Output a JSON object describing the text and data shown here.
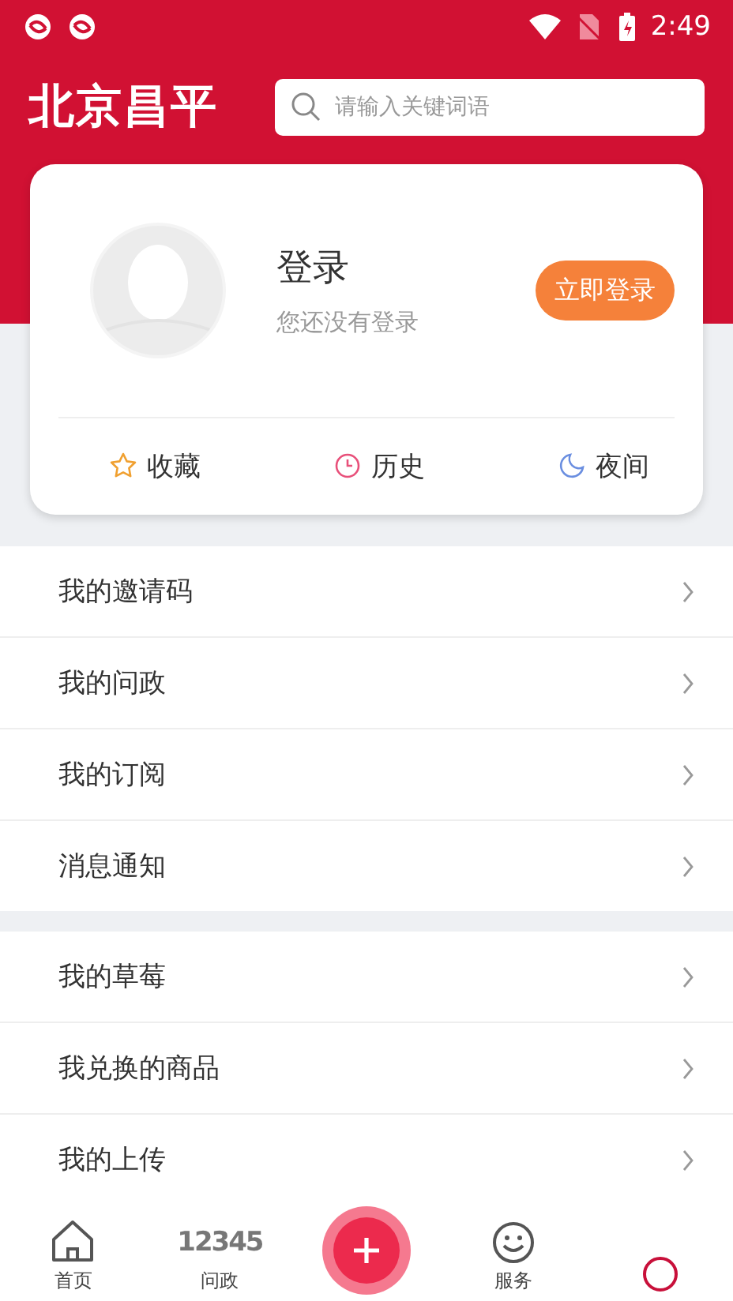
{
  "status_bar": {
    "time": "2:49"
  },
  "header": {
    "logo": "北京昌平",
    "search": {
      "placeholder": "请输入关键词语"
    }
  },
  "profile": {
    "name": "登录",
    "subtitle": "您还没有登录",
    "login_button": "立即登录",
    "shortcuts": [
      {
        "kind": "star",
        "label": "收藏"
      },
      {
        "kind": "clock",
        "label": "历史"
      },
      {
        "kind": "moon",
        "label": "夜间"
      }
    ]
  },
  "menu_groups": [
    {
      "items": [
        "我的邀请码",
        "我的问政",
        "我的订阅",
        "消息通知"
      ]
    },
    {
      "items": [
        "我的草莓",
        "我兑换的商品",
        "我的上传"
      ]
    }
  ],
  "bottom_nav": [
    {
      "kind": "home",
      "label": "首页",
      "selected": false
    },
    {
      "kind": "hotline",
      "label": "问政",
      "icon_text": "12345",
      "selected": false
    },
    {
      "kind": "plus",
      "selected": false
    },
    {
      "kind": "smile",
      "label": "服务",
      "selected": false
    },
    {
      "kind": "person",
      "selected": true
    }
  ]
}
